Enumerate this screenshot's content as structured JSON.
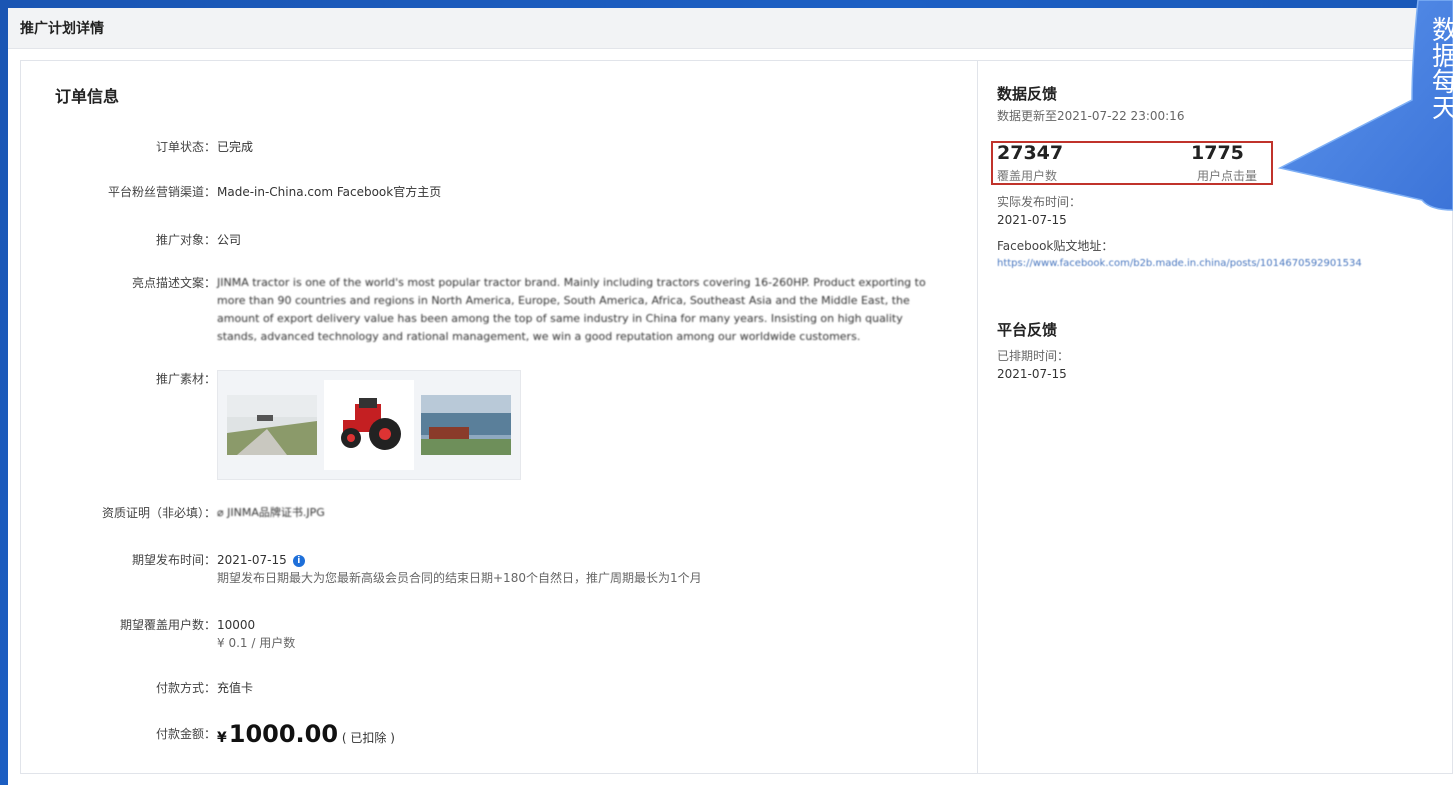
{
  "header": {
    "title": "推广计划详情"
  },
  "order": {
    "section_title": "订单信息",
    "fields": {
      "status_label": "订单状态：",
      "status_value": "已完成",
      "channel_label": "平台粉丝营销渠道：",
      "channel_value": "Made-in-China.com Facebook官方主页",
      "target_label": "推广对象：",
      "target_value": "公司",
      "desc_label": "亮点描述文案：",
      "desc_value": "JINMA tractor is one of the world's most popular tractor brand. Mainly including tractors covering 16-260HP. Product exporting to more than 90 countries and regions in North America, Europe, South America, Africa, Southeast Asia and the Middle East, the amount of export delivery value has been among the top of same industry in China for many years. Insisting on high quality stands, advanced technology and rational management, we win a good reputation among our worldwide customers.",
      "material_label": "推广素材：",
      "cert_label": "资质证明（非必填）：",
      "cert_value": "JINMA品牌证书.JPG",
      "date_label": "期望发布时间：",
      "date_value": "2021-07-15",
      "date_note": "期望发布日期最大为您最新高级会员合同的结束日期+180个自然日，推广周期最长为1个月",
      "users_label": "期望覆盖用户数：",
      "users_value": "10000",
      "users_note": "¥ 0.1 / 用户数",
      "pay_label": "付款方式：",
      "pay_value": "充值卡",
      "amount_label": "付款金额：",
      "amount_currency": "¥",
      "amount_value": "1000.00",
      "amount_note": "( 已扣除 )"
    }
  },
  "feedback": {
    "title": "数据反馈",
    "updated": "数据更新至2021-07-22 23:00:16",
    "reach_value": "27347",
    "reach_label": "覆盖用户数",
    "clicks_value": "1775",
    "clicks_label": "用户点击量",
    "publish_label": "实际发布时间：",
    "publish_value": "2021-07-15",
    "post_label": "Facebook贴文地址：",
    "post_url": "https://www.facebook.com/b2b.made.in.china/posts/1014670592901534"
  },
  "platform": {
    "title": "平台反馈",
    "scheduled_label": "已排期时间：",
    "scheduled_value": "2021-07-15"
  },
  "callout": {
    "lines": [
      "数",
      "据",
      "",
      "每",
      "天"
    ]
  },
  "colors": {
    "accent": "#1e6fd9",
    "highlight_border": "#c0332b",
    "background": "#1a55b3"
  }
}
